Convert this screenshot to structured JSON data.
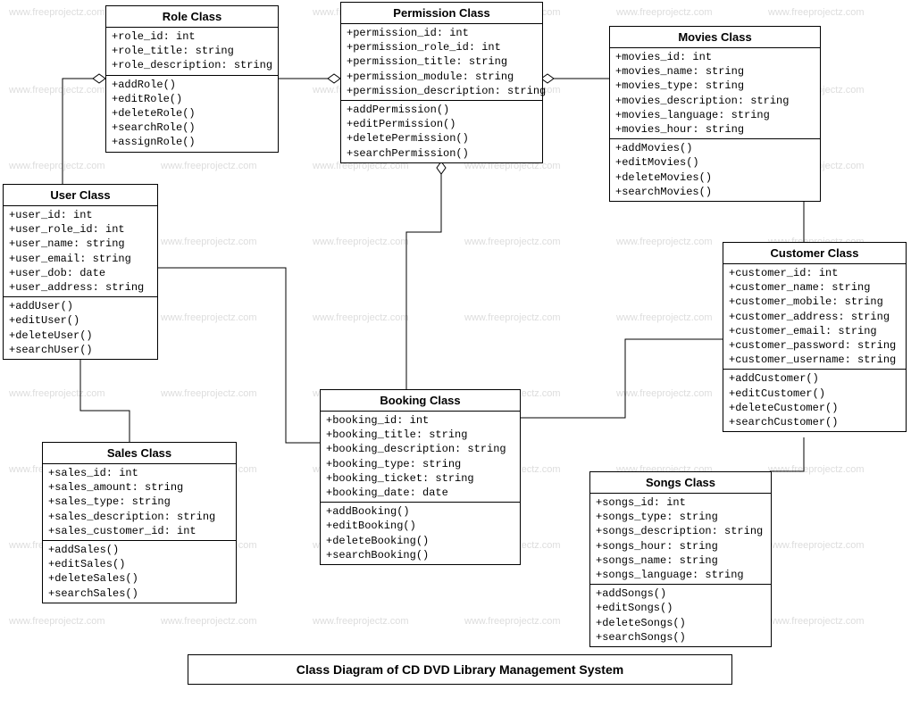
{
  "diagram_title": "Class Diagram of CD DVD Library Management System",
  "watermark_text": "www.freeprojectz.com",
  "classes": {
    "role": {
      "title": "Role Class",
      "attrs": [
        "+role_id: int",
        "+role_title: string",
        "+role_description: string"
      ],
      "methods": [
        "+addRole()",
        "+editRole()",
        "+deleteRole()",
        "+searchRole()",
        "+assignRole()"
      ]
    },
    "permission": {
      "title": "Permission Class",
      "attrs": [
        "+permission_id: int",
        "+permission_role_id: int",
        "+permission_title: string",
        "+permission_module: string",
        "+permission_description: string"
      ],
      "methods": [
        "+addPermission()",
        "+editPermission()",
        "+deletePermission()",
        "+searchPermission()"
      ]
    },
    "movies": {
      "title": "Movies Class",
      "attrs": [
        "+movies_id: int",
        "+movies_name: string",
        "+movies_type: string",
        "+movies_description: string",
        "+movies_language: string",
        "+movies_hour: string"
      ],
      "methods": [
        "+addMovies()",
        "+editMovies()",
        "+deleteMovies()",
        "+searchMovies()"
      ]
    },
    "user": {
      "title": "User Class",
      "attrs": [
        "+user_id: int",
        "+user_role_id: int",
        "+user_name: string",
        "+user_email: string",
        "+user_dob: date",
        "+user_address: string"
      ],
      "methods": [
        "+addUser()",
        "+editUser()",
        "+deleteUser()",
        "+searchUser()"
      ]
    },
    "customer": {
      "title": "Customer Class",
      "attrs": [
        "+customer_id: int",
        "+customer_name: string",
        "+customer_mobile: string",
        "+customer_address: string",
        "+customer_email: string",
        "+customer_password: string",
        "+customer_username: string"
      ],
      "methods": [
        "+addCustomer()",
        "+editCustomer()",
        "+deleteCustomer()",
        "+searchCustomer()"
      ]
    },
    "booking": {
      "title": "Booking Class",
      "attrs": [
        "+booking_id: int",
        "+booking_title: string",
        "+booking_description: string",
        "+booking_type: string",
        "+booking_ticket: string",
        "+booking_date: date"
      ],
      "methods": [
        "+addBooking()",
        "+editBooking()",
        "+deleteBooking()",
        "+searchBooking()"
      ]
    },
    "sales": {
      "title": "Sales Class",
      "attrs": [
        "+sales_id: int",
        "+sales_amount: string",
        "+sales_type: string",
        "+sales_description: string",
        "+sales_customer_id: int"
      ],
      "methods": [
        "+addSales()",
        "+editSales()",
        "+deleteSales()",
        "+searchSales()"
      ]
    },
    "songs": {
      "title": "Songs Class",
      "attrs": [
        "+songs_id: int",
        "+songs_type: string",
        "+songs_description: string",
        "+songs_hour: string",
        "+songs_name: string",
        "+songs_language: string"
      ],
      "methods": [
        "+addSongs()",
        "+editSongs()",
        "+deleteSongs()",
        "+searchSongs()"
      ]
    }
  }
}
